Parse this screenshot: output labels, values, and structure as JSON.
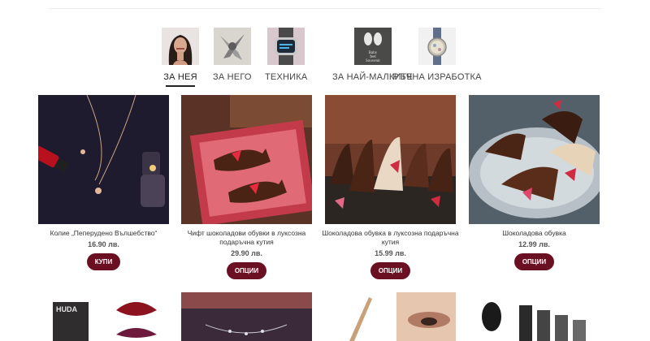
{
  "categories": [
    {
      "label": "ЗА НЕЯ",
      "active": true
    },
    {
      "label": "ЗА НЕГО",
      "active": false
    },
    {
      "label": "ТЕХНИКА",
      "active": false
    },
    {
      "label": "ЗА НАЙ-МАЛКИТЕ",
      "active": false
    },
    {
      "label": "РЪЧНА ИЗРАБОТКА",
      "active": false
    }
  ],
  "baby_thumb_text": "Baby\nfeet\nSouvenir",
  "products": [
    {
      "name": "Колие „Пеперудено Вълшебство“",
      "price": "16.90 лв.",
      "button": "КУПИ"
    },
    {
      "name": "Чифт шоколадови обувки в луксозна подаръчна кутия",
      "price": "29.90 лв.",
      "button": "ОПЦИИ"
    },
    {
      "name": "Шоколадова обувка в луксозна подаръчна кутия",
      "price": "15.99 лв.",
      "button": "ОПЦИИ"
    },
    {
      "name": "Шоколадова обувка",
      "price": "12.99 лв.",
      "button": "ОПЦИИ"
    }
  ],
  "row2_brand_text": "HUDA",
  "colors": {
    "accent": "#6b0f23"
  }
}
